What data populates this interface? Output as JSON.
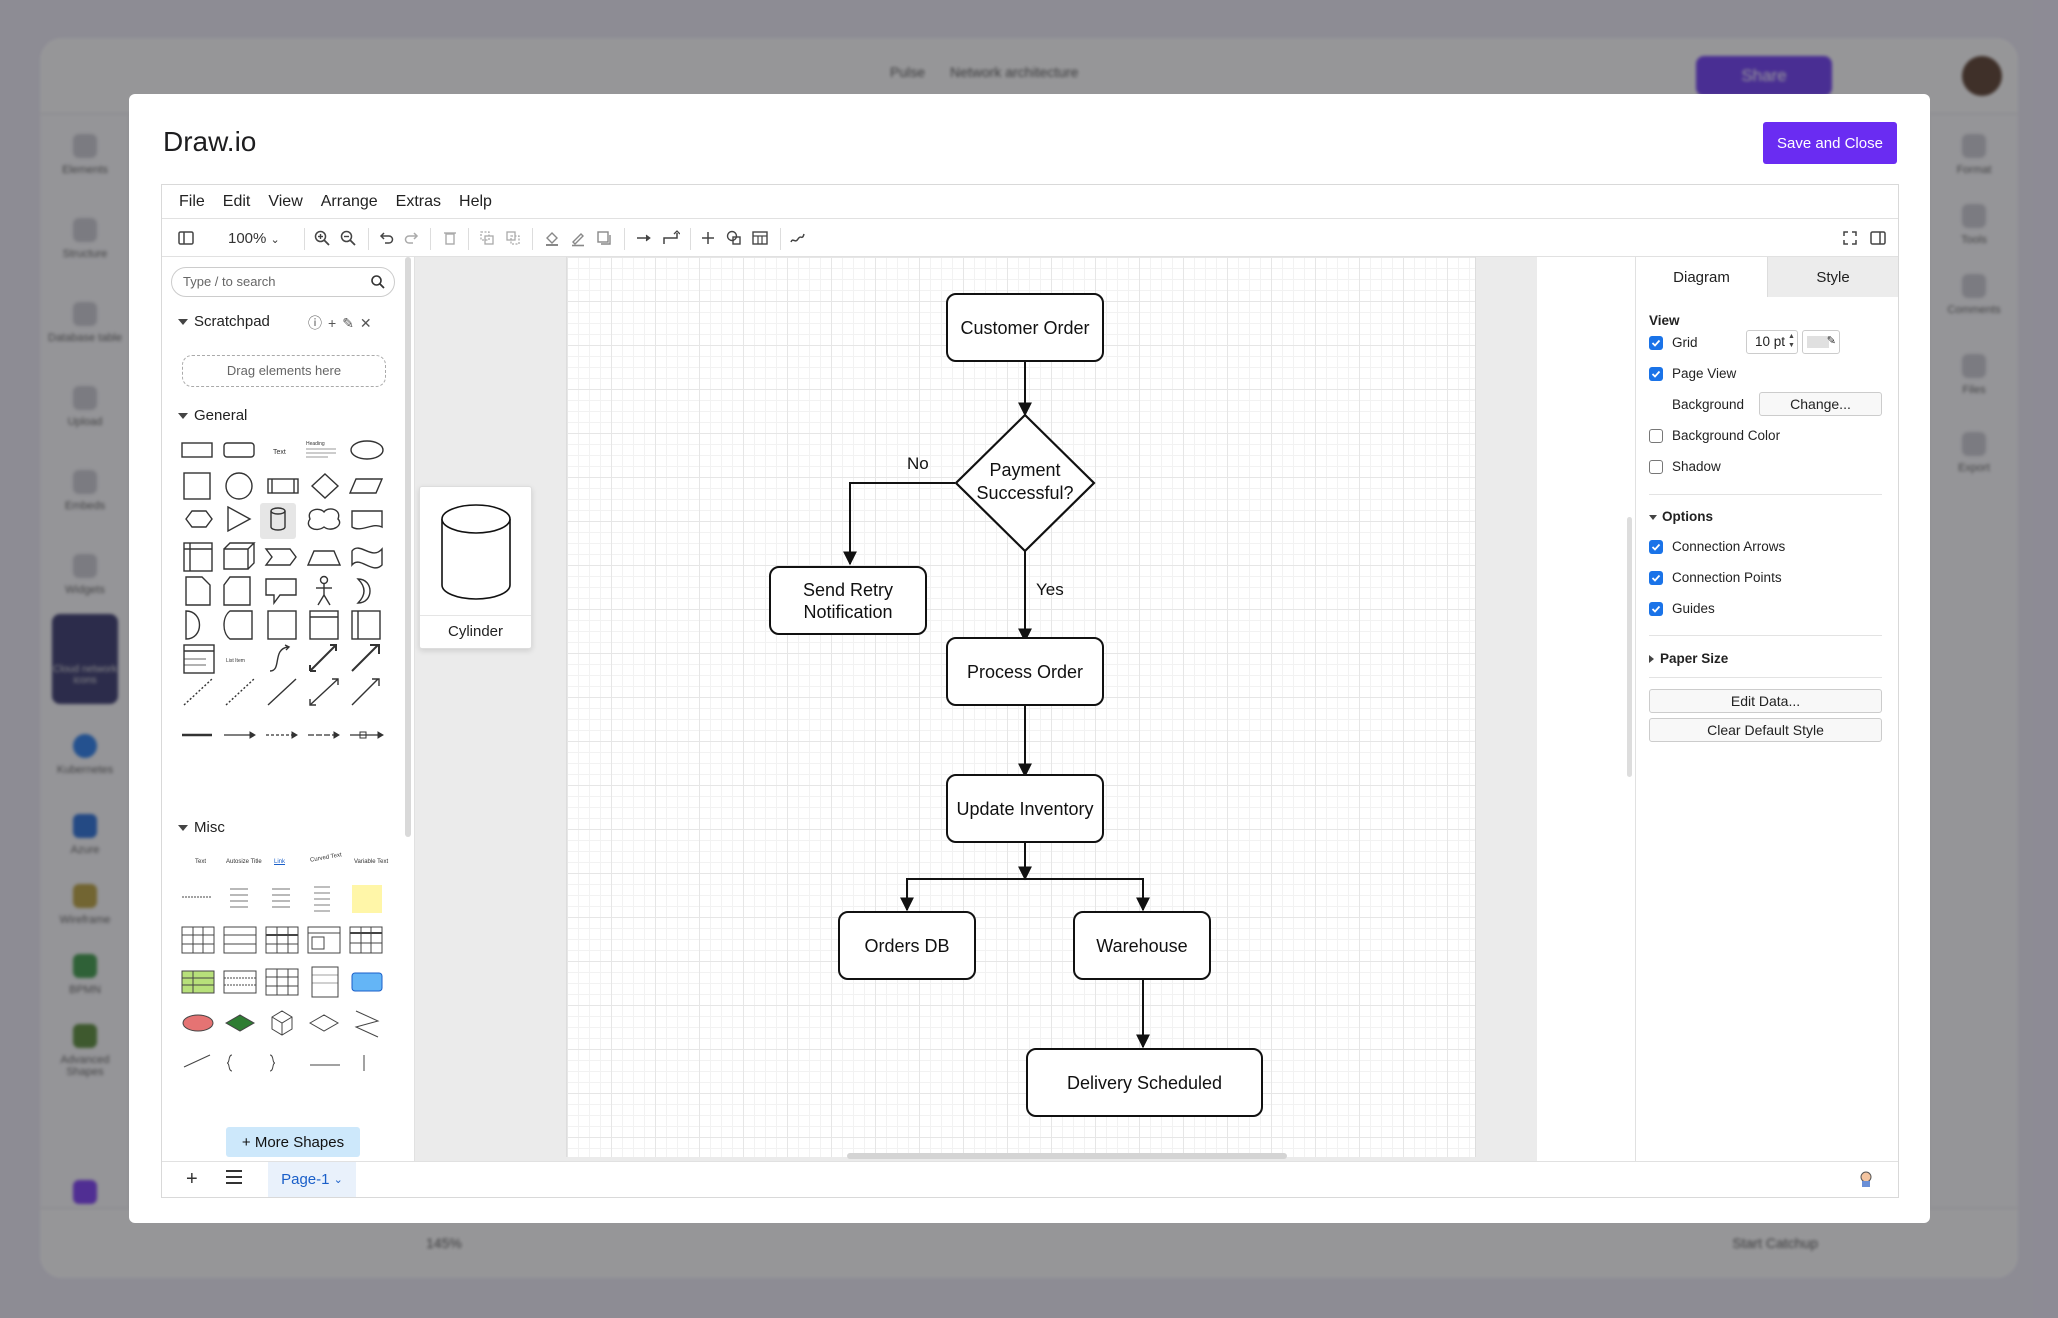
{
  "background_app": {
    "breadcrumb": "Pulse",
    "doc_title": "Network architecture",
    "share_label": "Share",
    "zoom": "145%",
    "catchup_label": "Start Catchup",
    "left_tools": [
      "Elements",
      "Structure",
      "Database table",
      "Upload",
      "Embeds",
      "Widgets",
      "Cloud network icons",
      "Kubernetes",
      "Azure",
      "Wireframe",
      "BPMN",
      "Advanced Shapes"
    ],
    "right_tools": [
      "Format",
      "Tools",
      "Comments",
      "Files",
      "Export"
    ]
  },
  "modal": {
    "title": "Draw.io",
    "save_close": "Save and Close"
  },
  "menu": [
    "File",
    "Edit",
    "View",
    "Arrange",
    "Extras",
    "Help"
  ],
  "toolbar": {
    "zoom": "100%"
  },
  "sidebar": {
    "search_placeholder": "Type / to search",
    "scratchpad": {
      "title": "Scratchpad",
      "drag_hint": "Drag elements here"
    },
    "general_title": "General",
    "misc_title": "Misc",
    "misc_texts": [
      "Text",
      "Autosize Title",
      "Link",
      "Curved Text",
      "Variable Text"
    ],
    "more_shapes": "+ More Shapes"
  },
  "hover_preview": {
    "label": "Cylinder"
  },
  "diagram": {
    "nodes": {
      "customer_order": "Customer Order",
      "payment": "Payment Successful?",
      "retry": "Send Retry Notification",
      "process": "Process Order",
      "inventory": "Update Inventory",
      "orders_db": "Orders DB",
      "warehouse": "Warehouse",
      "delivery": "Delivery Scheduled"
    },
    "edge_labels": {
      "no": "No",
      "yes": "Yes"
    }
  },
  "format_panel": {
    "tabs": [
      "Diagram",
      "Style"
    ],
    "view_title": "View",
    "grid": {
      "label": "Grid",
      "checked": true,
      "size": "10 pt"
    },
    "page_view": {
      "label": "Page View",
      "checked": true
    },
    "background": {
      "label": "Background",
      "button": "Change..."
    },
    "background_color": {
      "label": "Background Color",
      "checked": false
    },
    "shadow": {
      "label": "Shadow",
      "checked": false
    },
    "options_title": "Options",
    "connection_arrows": {
      "label": "Connection Arrows",
      "checked": true
    },
    "connection_points": {
      "label": "Connection Points",
      "checked": true
    },
    "guides": {
      "label": "Guides",
      "checked": true
    },
    "paper_size_title": "Paper Size",
    "edit_data": "Edit Data...",
    "clear_style": "Clear Default Style"
  },
  "pages": {
    "current": "Page-1"
  },
  "colors": {
    "accent": "#6a2cf2",
    "checkbox": "#1a73e8",
    "page_tab": "#1a5fc9"
  }
}
